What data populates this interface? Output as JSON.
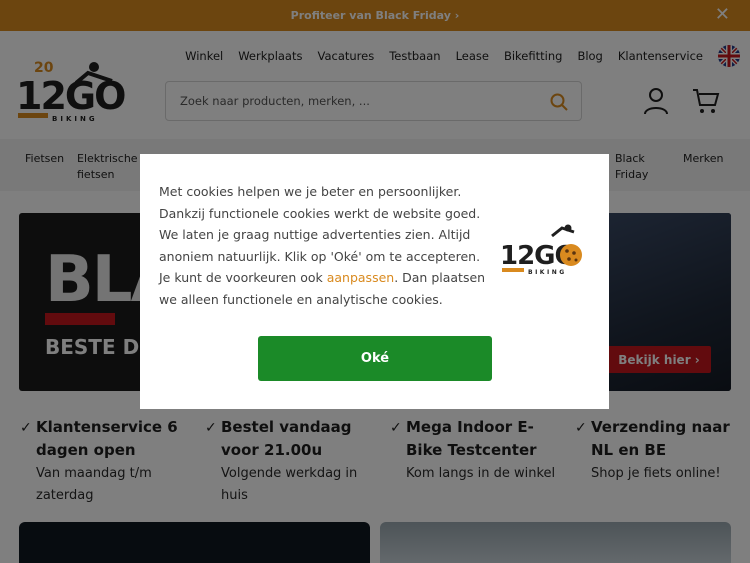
{
  "topbar": {
    "promo": "Profiteer van Black Friday ›",
    "close": "✕"
  },
  "logo": {
    "text": "12GO",
    "sub": "BIKING",
    "badge": "20"
  },
  "topnav": [
    "Winkel",
    "Werkplaats",
    "Vacatures",
    "Testbaan",
    "Lease",
    "Bikefitting",
    "Blog",
    "Klantenservice"
  ],
  "search": {
    "placeholder": "Zoek naar producten, merken, ..."
  },
  "categories": {
    "fietsen": "Fietsen",
    "elektrische1": "Elektrische",
    "elektrische2": "fietsen",
    "black1": "Black",
    "black2": "Friday",
    "merken": "Merken"
  },
  "banner": {
    "big": "BLA",
    "sub": "BESTE D",
    "cta": "Bekijk hier ›"
  },
  "usps": [
    {
      "title": "Klantenservice 6 dagen open",
      "desc": "Van maandag t/m zaterdag"
    },
    {
      "title": "Bestel vandaag voor 21.00u",
      "desc": "Volgende werkdag in huis"
    },
    {
      "title": "Mega Indoor E-Bike Testcenter",
      "desc": "Kom langs in de winkel"
    },
    {
      "title": "Verzending naar NL en BE",
      "desc": "Shop je fiets online!"
    }
  ],
  "cookie": {
    "text_before": "Met cookies helpen we je beter en persoonlijker. Dankzij functionele cookies werkt de website goed. We laten je graag nuttige advertenties zien. Altijd anoniem natuurlijk. Klik op 'Oké' om te accepteren. Je kunt de voorkeuren ook ",
    "link": "aanpassen",
    "text_after": ". Dan plaatsen we alleen functionele en analytische cookies.",
    "ok": "Oké"
  },
  "colors": {
    "orange": "#d98a1f",
    "green": "#1b8a28",
    "red": "#c4161c"
  }
}
